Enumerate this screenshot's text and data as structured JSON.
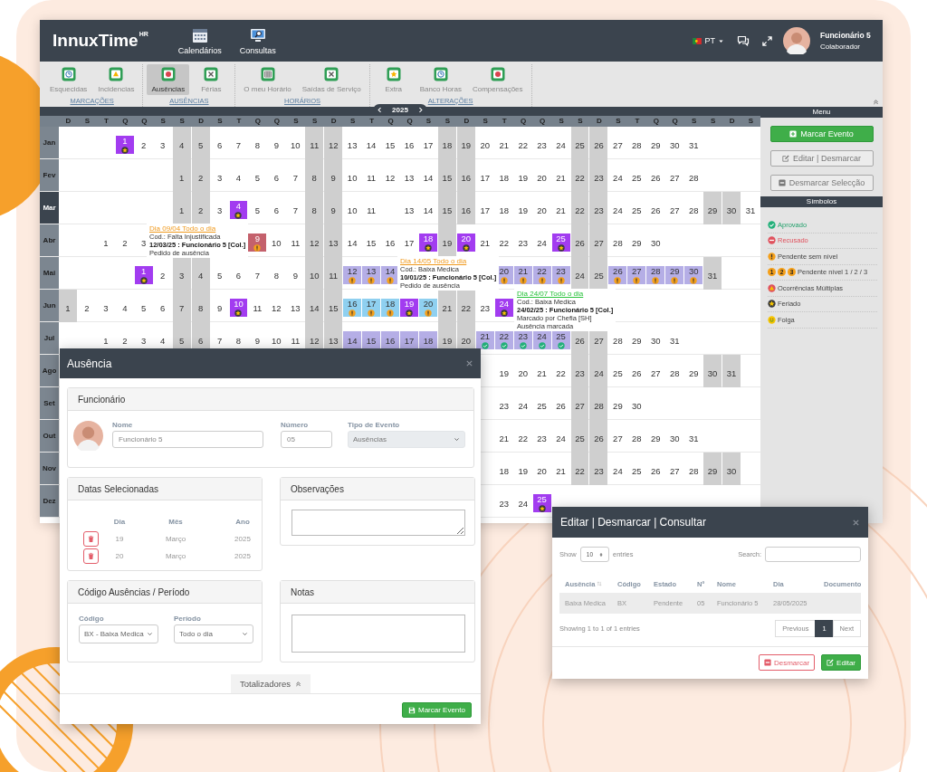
{
  "header": {
    "logo": "InnuxTime",
    "logo_superscript": "HR",
    "nav": [
      {
        "label": "Calendários"
      },
      {
        "label": "Consultas"
      }
    ],
    "language": "PT",
    "user": {
      "name": "Funcionário 5",
      "role": "Colaborador"
    }
  },
  "toolbar": {
    "groups": [
      {
        "label": "MARCAÇÕES",
        "items": [
          {
            "label": "Esquecidas",
            "selected": false
          },
          {
            "label": "Incidencias",
            "selected": false
          }
        ]
      },
      {
        "label": "AUSÊNCIAS",
        "items": [
          {
            "label": "Ausências",
            "selected": true
          },
          {
            "label": "Férias",
            "selected": false
          }
        ]
      },
      {
        "label": "HORÁRIOS",
        "items": [
          {
            "label": "O meu Horário",
            "selected": false
          },
          {
            "label": "Saídas de Serviço",
            "selected": false
          }
        ]
      },
      {
        "label": "ALTERAÇÕES",
        "items": [
          {
            "label": "Extra",
            "selected": false
          },
          {
            "label": "Banco Horas",
            "selected": false
          },
          {
            "label": "Compensações",
            "selected": false
          }
        ]
      }
    ]
  },
  "calendar": {
    "year": "2025",
    "weekdays": [
      "D",
      "S",
      "T",
      "Q",
      "Q",
      "S",
      "S",
      "D",
      "S",
      "T",
      "Q",
      "Q",
      "S",
      "S",
      "D",
      "S",
      "T",
      "Q",
      "Q",
      "S",
      "S",
      "D",
      "S",
      "T",
      "Q",
      "Q",
      "S",
      "S",
      "D",
      "S",
      "T",
      "Q",
      "Q",
      "S",
      "S",
      "D",
      "S"
    ],
    "months": [
      {
        "label": "Jan",
        "selected": false,
        "cells": [
          null,
          null,
          null,
          {
            "day": "1",
            "kind": "holiday"
          },
          {
            "day": "2",
            "kind": "workday"
          },
          {
            "day": "3",
            "kind": "workday"
          },
          {
            "day": "4",
            "kind": "weekend"
          },
          {
            "day": "5",
            "kind": "weekend"
          },
          {
            "day": "6",
            "kind": "workday"
          },
          {
            "day": "7",
            "kind": "workday"
          },
          {
            "day": "8",
            "kind": "workday"
          },
          {
            "day": "9",
            "kind": "workday"
          },
          {
            "day": "10",
            "kind": "workday"
          },
          {
            "day": "11",
            "kind": "weekend"
          },
          {
            "day": "12",
            "kind": "weekend"
          },
          {
            "day": "13",
            "kind": "workday"
          },
          {
            "day": "14",
            "kind": "workday"
          },
          {
            "day": "15",
            "kind": "workday"
          },
          {
            "day": "16",
            "kind": "workday"
          },
          {
            "day": "17",
            "kind": "workday"
          },
          {
            "day": "18",
            "kind": "weekend"
          },
          {
            "day": "19",
            "kind": "weekend"
          },
          {
            "day": "20",
            "kind": "workday"
          },
          {
            "day": "21",
            "kind": "workday"
          },
          {
            "day": "22",
            "kind": "workday"
          },
          {
            "day": "23",
            "kind": "workday"
          },
          {
            "day": "24",
            "kind": "workday"
          },
          {
            "day": "25",
            "kind": "weekend"
          },
          {
            "day": "26",
            "kind": "weekend"
          },
          {
            "day": "27",
            "kind": "workday"
          },
          {
            "day": "28",
            "kind": "workday"
          },
          {
            "day": "29",
            "kind": "workday"
          },
          {
            "day": "30",
            "kind": "workday"
          },
          {
            "day": "31",
            "kind": "workday"
          }
        ]
      },
      {
        "label": "Fev",
        "selected": false,
        "cells": [
          null,
          null,
          null,
          null,
          null,
          null,
          {
            "day": "1",
            "kind": "weekend"
          },
          {
            "day": "2",
            "kind": "weekend"
          },
          {
            "day": "3",
            "kind": "workday"
          },
          {
            "day": "4",
            "kind": "workday"
          },
          {
            "day": "5",
            "kind": "workday"
          },
          {
            "day": "6",
            "kind": "workday"
          },
          {
            "day": "7",
            "kind": "workday"
          },
          {
            "day": "8",
            "kind": "weekend"
          },
          {
            "day": "9",
            "kind": "weekend"
          },
          {
            "day": "10",
            "kind": "workday"
          },
          {
            "day": "11",
            "kind": "workday"
          },
          {
            "day": "12",
            "kind": "workday"
          },
          {
            "day": "13",
            "kind": "workday"
          },
          {
            "day": "14",
            "kind": "workday"
          },
          {
            "day": "15",
            "kind": "weekend"
          },
          {
            "day": "16",
            "kind": "weekend"
          },
          {
            "day": "17",
            "kind": "workday"
          },
          {
            "day": "18",
            "kind": "workday"
          },
          {
            "day": "19",
            "kind": "workday"
          },
          {
            "day": "20",
            "kind": "workday"
          },
          {
            "day": "21",
            "kind": "workday"
          },
          {
            "day": "22",
            "kind": "weekend"
          },
          {
            "day": "23",
            "kind": "weekend"
          },
          {
            "day": "24",
            "kind": "workday"
          },
          {
            "day": "25",
            "kind": "workday"
          },
          {
            "day": "26",
            "kind": "workday"
          },
          {
            "day": "27",
            "kind": "workday"
          },
          {
            "day": "28",
            "kind": "workday"
          }
        ]
      },
      {
        "label": "Mar",
        "selected": true,
        "cells": [
          null,
          null,
          null,
          null,
          null,
          null,
          {
            "day": "1",
            "kind": "weekend"
          },
          {
            "day": "2",
            "kind": "weekend"
          },
          {
            "day": "3",
            "kind": "workday"
          },
          {
            "day": "4",
            "kind": "holiday"
          },
          {
            "day": "5",
            "kind": "workday"
          },
          {
            "day": "6",
            "kind": "workday"
          },
          {
            "day": "7",
            "kind": "workday"
          },
          {
            "day": "8",
            "kind": "weekend"
          },
          {
            "day": "9",
            "kind": "weekend"
          },
          {
            "day": "10",
            "kind": "workday"
          },
          {
            "day": "11",
            "kind": "workday"
          },
          null,
          {
            "day": "13",
            "kind": "workday"
          },
          {
            "day": "14",
            "kind": "workday"
          },
          {
            "day": "15",
            "kind": "weekend"
          },
          {
            "day": "16",
            "kind": "weekend"
          },
          {
            "day": "17",
            "kind": "workday"
          },
          {
            "day": "18",
            "kind": "workday"
          },
          {
            "day": "19",
            "kind": "workday"
          },
          {
            "day": "20",
            "kind": "workday"
          },
          {
            "day": "21",
            "kind": "workday"
          },
          {
            "day": "22",
            "kind": "weekend"
          },
          {
            "day": "23",
            "kind": "weekend"
          },
          {
            "day": "24",
            "kind": "workday"
          },
          {
            "day": "25",
            "kind": "workday"
          },
          {
            "day": "26",
            "kind": "workday"
          },
          {
            "day": "27",
            "kind": "workday"
          },
          {
            "day": "28",
            "kind": "workday"
          },
          {
            "day": "29",
            "kind": "weekend"
          },
          {
            "day": "30",
            "kind": "weekend"
          },
          {
            "day": "31",
            "kind": "workday"
          }
        ]
      },
      {
        "label": "Abr",
        "selected": false,
        "cells": [
          null,
          null,
          {
            "day": "1",
            "kind": "workday"
          },
          {
            "day": "2",
            "kind": "workday"
          },
          {
            "day": "3",
            "kind": "workday"
          },
          null,
          null,
          null,
          null,
          null,
          {
            "day": "9",
            "kind": "refused"
          },
          {
            "day": "10",
            "kind": "workday"
          },
          {
            "day": "11",
            "kind": "workday"
          },
          {
            "day": "12",
            "kind": "weekend"
          },
          {
            "day": "13",
            "kind": "weekend"
          },
          {
            "day": "14",
            "kind": "workday"
          },
          {
            "day": "15",
            "kind": "workday"
          },
          {
            "day": "16",
            "kind": "workday"
          },
          {
            "day": "17",
            "kind": "workday"
          },
          {
            "day": "18",
            "kind": "holiday"
          },
          {
            "day": "19",
            "kind": "weekend"
          },
          {
            "day": "20",
            "kind": "holiday"
          },
          {
            "day": "21",
            "kind": "workday"
          },
          {
            "day": "22",
            "kind": "workday"
          },
          {
            "day": "23",
            "kind": "workday"
          },
          {
            "day": "24",
            "kind": "workday"
          },
          {
            "day": "25",
            "kind": "holiday"
          },
          {
            "day": "26",
            "kind": "weekend"
          },
          {
            "day": "27",
            "kind": "weekend"
          },
          {
            "day": "28",
            "kind": "workday"
          },
          {
            "day": "29",
            "kind": "workday"
          },
          {
            "day": "30",
            "kind": "workday"
          }
        ]
      },
      {
        "label": "Mai",
        "selected": false,
        "cells": [
          null,
          null,
          null,
          null,
          {
            "day": "1",
            "kind": "holiday"
          },
          {
            "day": "2",
            "kind": "workday"
          },
          {
            "day": "3",
            "kind": "weekend"
          },
          {
            "day": "4",
            "kind": "weekend"
          },
          {
            "day": "5",
            "kind": "workday"
          },
          {
            "day": "6",
            "kind": "workday"
          },
          {
            "day": "7",
            "kind": "workday"
          },
          {
            "day": "8",
            "kind": "workday"
          },
          {
            "day": "9",
            "kind": "workday"
          },
          {
            "day": "10",
            "kind": "weekend"
          },
          {
            "day": "11",
            "kind": "weekend"
          },
          {
            "day": "12",
            "kind": "pending"
          },
          {
            "day": "13",
            "kind": "pending"
          },
          {
            "day": "14",
            "kind": "pending"
          },
          null,
          null,
          null,
          null,
          null,
          {
            "day": "20",
            "kind": "pending"
          },
          {
            "day": "21",
            "kind": "pending"
          },
          {
            "day": "22",
            "kind": "pending"
          },
          {
            "day": "23",
            "kind": "pending"
          },
          {
            "day": "24",
            "kind": "weekend"
          },
          {
            "day": "25",
            "kind": "weekend"
          },
          {
            "day": "26",
            "kind": "pending"
          },
          {
            "day": "27",
            "kind": "pending"
          },
          {
            "day": "28",
            "kind": "pending"
          },
          {
            "day": "29",
            "kind": "pending"
          },
          {
            "day": "30",
            "kind": "pending"
          },
          {
            "day": "31",
            "kind": "weekend"
          }
        ]
      },
      {
        "label": "Jun",
        "selected": false,
        "cells": [
          {
            "day": "1",
            "kind": "weekend"
          },
          {
            "day": "2",
            "kind": "workday"
          },
          {
            "day": "3",
            "kind": "workday"
          },
          {
            "day": "4",
            "kind": "workday"
          },
          {
            "day": "5",
            "kind": "workday"
          },
          {
            "day": "6",
            "kind": "workday"
          },
          {
            "day": "7",
            "kind": "weekend"
          },
          {
            "day": "8",
            "kind": "weekend"
          },
          {
            "day": "9",
            "kind": "workday"
          },
          {
            "day": "10",
            "kind": "holiday"
          },
          {
            "day": "11",
            "kind": "workday"
          },
          {
            "day": "12",
            "kind": "workday"
          },
          {
            "day": "13",
            "kind": "workday"
          },
          {
            "day": "14",
            "kind": "weekend"
          },
          {
            "day": "15",
            "kind": "weekend"
          },
          {
            "day": "16",
            "kind": "waiting"
          },
          {
            "day": "17",
            "kind": "waiting"
          },
          {
            "day": "18",
            "kind": "waiting"
          },
          {
            "day": "19",
            "kind": "holiday"
          },
          {
            "day": "20",
            "kind": "waiting"
          },
          {
            "day": "21",
            "kind": "weekend"
          },
          {
            "day": "22",
            "kind": "weekend"
          },
          {
            "day": "23",
            "kind": "workday"
          },
          {
            "day": "24",
            "kind": "holiday"
          }
        ]
      },
      {
        "label": "Jul",
        "selected": false,
        "cells": [
          null,
          null,
          {
            "day": "1",
            "kind": "workday"
          },
          {
            "day": "2",
            "kind": "workday"
          },
          {
            "day": "3",
            "kind": "workday"
          },
          {
            "day": "4",
            "kind": "workday"
          },
          {
            "day": "5",
            "kind": "weekend"
          },
          {
            "day": "6",
            "kind": "weekend"
          },
          {
            "day": "7",
            "kind": "workday"
          },
          {
            "day": "8",
            "kind": "workday"
          },
          {
            "day": "9",
            "kind": "workday"
          },
          {
            "day": "10",
            "kind": "workday"
          },
          {
            "day": "11",
            "kind": "workday"
          },
          {
            "day": "12",
            "kind": "weekend"
          },
          {
            "day": "13",
            "kind": "weekend"
          },
          {
            "day": "14",
            "kind": "marked"
          },
          {
            "day": "15",
            "kind": "marked"
          },
          {
            "day": "16",
            "kind": "marked"
          },
          {
            "day": "17",
            "kind": "marked"
          },
          {
            "day": "18",
            "kind": "marked"
          },
          {
            "day": "19",
            "kind": "weekend"
          },
          {
            "day": "20",
            "kind": "weekend"
          },
          {
            "day": "21",
            "kind": "approved"
          },
          {
            "day": "22",
            "kind": "approved"
          },
          {
            "day": "23",
            "kind": "approved"
          },
          {
            "day": "24",
            "kind": "approved"
          },
          {
            "day": "25",
            "kind": "approved"
          },
          {
            "day": "26",
            "kind": "weekend"
          },
          {
            "day": "27",
            "kind": "weekend"
          },
          {
            "day": "28",
            "kind": "workday"
          },
          {
            "day": "29",
            "kind": "workday"
          },
          {
            "day": "30",
            "kind": "workday"
          },
          {
            "day": "31",
            "kind": "workday"
          }
        ]
      },
      {
        "label": "Ago",
        "selected": false,
        "cells": [
          null,
          null,
          null,
          null,
          null,
          null,
          null,
          null,
          null,
          null,
          null,
          null,
          null,
          null,
          null,
          null,
          null,
          null,
          null,
          null,
          null,
          null,
          null,
          {
            "day": "19",
            "kind": "workday"
          },
          {
            "day": "20",
            "kind": "workday"
          },
          {
            "day": "21",
            "kind": "workday"
          },
          {
            "day": "22",
            "kind": "workday"
          },
          {
            "day": "23",
            "kind": "weekend"
          },
          {
            "day": "24",
            "kind": "weekend"
          },
          {
            "day": "25",
            "kind": "workday"
          },
          {
            "day": "26",
            "kind": "workday"
          },
          {
            "day": "27",
            "kind": "workday"
          },
          {
            "day": "28",
            "kind": "workday"
          },
          {
            "day": "29",
            "kind": "workday"
          },
          {
            "day": "30",
            "kind": "weekend"
          },
          {
            "day": "31",
            "kind": "weekend"
          }
        ]
      },
      {
        "label": "Set",
        "selected": false,
        "cells": [
          null,
          null,
          null,
          null,
          null,
          null,
          null,
          null,
          null,
          null,
          null,
          null,
          null,
          null,
          null,
          null,
          null,
          null,
          null,
          null,
          null,
          null,
          null,
          {
            "day": "23",
            "kind": "workday"
          },
          {
            "day": "24",
            "kind": "workday"
          },
          {
            "day": "25",
            "kind": "workday"
          },
          {
            "day": "26",
            "kind": "workday"
          },
          {
            "day": "27",
            "kind": "weekend"
          },
          {
            "day": "28",
            "kind": "weekend"
          },
          {
            "day": "29",
            "kind": "workday"
          },
          {
            "day": "30",
            "kind": "workday"
          }
        ]
      },
      {
        "label": "Out",
        "selected": false,
        "cells": [
          null,
          null,
          null,
          null,
          null,
          null,
          null,
          null,
          null,
          null,
          null,
          null,
          null,
          null,
          null,
          null,
          null,
          null,
          null,
          null,
          null,
          null,
          null,
          {
            "day": "21",
            "kind": "workday"
          },
          {
            "day": "22",
            "kind": "workday"
          },
          {
            "day": "23",
            "kind": "workday"
          },
          {
            "day": "24",
            "kind": "workday"
          },
          {
            "day": "25",
            "kind": "weekend"
          },
          {
            "day": "26",
            "kind": "weekend"
          },
          {
            "day": "27",
            "kind": "workday"
          },
          {
            "day": "28",
            "kind": "workday"
          },
          {
            "day": "29",
            "kind": "workday"
          },
          {
            "day": "30",
            "kind": "workday"
          },
          {
            "day": "31",
            "kind": "workday"
          }
        ]
      },
      {
        "label": "Nov",
        "selected": false,
        "cells": [
          null,
          null,
          null,
          null,
          null,
          null,
          null,
          null,
          null,
          null,
          null,
          null,
          null,
          null,
          null,
          null,
          null,
          null,
          null,
          null,
          null,
          null,
          null,
          {
            "day": "18",
            "kind": "workday"
          },
          {
            "day": "19",
            "kind": "workday"
          },
          {
            "day": "20",
            "kind": "workday"
          },
          {
            "day": "21",
            "kind": "workday"
          },
          {
            "day": "22",
            "kind": "weekend"
          },
          {
            "day": "23",
            "kind": "weekend"
          },
          {
            "day": "24",
            "kind": "workday"
          },
          {
            "day": "25",
            "kind": "workday"
          },
          {
            "day": "26",
            "kind": "workday"
          },
          {
            "day": "27",
            "kind": "workday"
          },
          {
            "day": "28",
            "kind": "workday"
          },
          {
            "day": "29",
            "kind": "weekend"
          },
          {
            "day": "30",
            "kind": "weekend"
          }
        ]
      },
      {
        "label": "Dez",
        "selected": false,
        "cells": [
          null,
          null,
          null,
          null,
          null,
          null,
          null,
          null,
          null,
          null,
          null,
          null,
          null,
          null,
          null,
          null,
          null,
          null,
          null,
          null,
          null,
          null,
          null,
          {
            "day": "23",
            "kind": "workday"
          },
          {
            "day": "24",
            "kind": "workday"
          },
          {
            "day": "25",
            "kind": "holiday"
          }
        ]
      }
    ],
    "tooltips": [
      {
        "kind": "pending",
        "title": "Dia 09/04 Todo o dia",
        "code": "Cod.: Falta Injustificada",
        "author": "12/03/25 : Funcionário 5 [Col.]",
        "notes": [
          "Pedido de ausência"
        ]
      },
      {
        "kind": "pending",
        "title": "Dia 14/05 Todo o dia",
        "code": "Cod.: Baixa Medica",
        "author": "10/01/25 : Funcionário 5 [Col.]",
        "notes": [
          "Pedido de ausência"
        ]
      },
      {
        "kind": "approved",
        "title": "Dia 24/07 Todo o dia",
        "code": "Cod.: Baixa Medica",
        "author": "24/02/25 : Funcionário 5 [Col.]",
        "notes": [
          "Marcado por Chefia [SH]",
          "Ausência marcada"
        ]
      }
    ]
  },
  "menu": {
    "title": "Menu",
    "buttons": [
      {
        "label": "Marcar Evento",
        "kind": "primary"
      },
      {
        "label": "Editar | Desmarcar",
        "kind": "outline"
      },
      {
        "label": "Desmarcar Selecção",
        "kind": "outline"
      }
    ]
  },
  "symbols": {
    "title": "Símbolos",
    "items": [
      {
        "kind": "approved",
        "label": "Aprovado"
      },
      {
        "kind": "refused",
        "label": "Recusado"
      },
      {
        "kind": "pending",
        "label": "Pendente sem nível"
      },
      {
        "kind": "levels",
        "badges": [
          "1",
          "2",
          "3"
        ],
        "label": "Pendente nível 1 / 2 / 3"
      },
      {
        "kind": "multiple",
        "label": "Ocorrências Múltiplas"
      },
      {
        "kind": "holiday",
        "label": "Feriado"
      },
      {
        "kind": "dayoff",
        "label": "Folga"
      }
    ]
  },
  "absence_dialog": {
    "title": "Ausência",
    "employee_panel": {
      "title": "Funcionário",
      "fields": [
        {
          "label": "Nome",
          "value": "Funcionário 5",
          "kind": "input",
          "disabled": false
        },
        {
          "label": "Número",
          "value": "05",
          "kind": "input",
          "disabled": false
        },
        {
          "label": "Tipo de Evento",
          "value": "Ausências",
          "kind": "select",
          "disabled": true
        }
      ]
    },
    "dates_panel": {
      "title": "Datas Selecionadas",
      "columns": [
        "Dia",
        "Mês",
        "Ano"
      ],
      "rows": [
        [
          "19",
          "Março",
          "2025"
        ],
        [
          "20",
          "Março",
          "2025"
        ]
      ]
    },
    "observations_panel": {
      "title": "Observações"
    },
    "code_panel": {
      "title": "Código Ausências / Período",
      "fields": [
        {
          "label": "Código",
          "value": "BX - Baixa Medica"
        },
        {
          "label": "Período",
          "value": "Todo o dia"
        }
      ]
    },
    "notes_panel": {
      "title": "Notas"
    },
    "totals_label": "Totalizadores",
    "submit": "Marcar Evento"
  },
  "edit_dialog": {
    "title": "Editar | Desmarcar | Consultar",
    "show_label": "Show",
    "page_size": "10",
    "entries_label": "entries",
    "search_label": "Search:",
    "columns": [
      {
        "label": "Ausência",
        "sorted": true
      },
      {
        "label": "Código",
        "sorted": false
      },
      {
        "label": "Estado",
        "sorted": false
      },
      {
        "label": "Nº",
        "sorted": false
      },
      {
        "label": "Nome",
        "sorted": false
      },
      {
        "label": "Dia",
        "sorted": false
      },
      {
        "label": "Documento",
        "sorted": false
      }
    ],
    "rows": [
      [
        "Baixa Medica",
        "BX",
        "Pendente",
        "05",
        "Funcionário 5",
        "28/05/2025"
      ]
    ],
    "info": "Showing 1 to 1 of 1 entries",
    "pages": [
      {
        "label": "Previous",
        "selected": false
      },
      {
        "label": "1",
        "selected": true
      },
      {
        "label": "Next",
        "selected": false
      }
    ],
    "buttons": [
      {
        "label": "Desmarcar",
        "kind": "danger"
      },
      {
        "label": "Editar",
        "kind": "success"
      }
    ]
  }
}
